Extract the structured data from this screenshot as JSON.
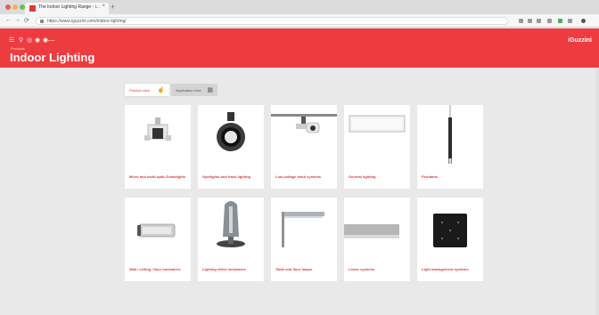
{
  "browser": {
    "tab_title": "The Indoor Lighting Range - i...",
    "tab_close": "×",
    "new_tab": "+",
    "back": "←",
    "forward": "→",
    "reload": "⟳",
    "url": "https://www.iguzzini.com/indoor-lighting/"
  },
  "header": {
    "brand": "iGuzzini",
    "breadcrumb": "Products",
    "title": "Indoor Lighting",
    "menu_icon": "☰",
    "search_icon": "⚲",
    "globe_icon": "◎",
    "user_icon": "◉",
    "more_icon": "◉—"
  },
  "views": {
    "product_view": "Product view",
    "application_view": "Application view"
  },
  "cards": [
    {
      "label": "Micro and multi-optic Downlights",
      "icon": "downlight"
    },
    {
      "label": "Spotlights and track lighting",
      "icon": "spotlight"
    },
    {
      "label": "Low-voltage track systems",
      "icon": "track"
    },
    {
      "label": "General lighting",
      "icon": "panel"
    },
    {
      "label": "Pendants",
      "icon": "pendant"
    },
    {
      "label": "Wall / ceiling / floor luminaires",
      "icon": "wall-luminaire"
    },
    {
      "label": "Lighting effect luminaires",
      "icon": "effect-luminaire"
    },
    {
      "label": "Table and floor lamps",
      "icon": "floor-lamp"
    },
    {
      "label": "Linear systems",
      "icon": "linear"
    },
    {
      "label": "Light management systems",
      "icon": "control-panel"
    }
  ],
  "colors": {
    "brand_red": "#ee3b3f",
    "label_red": "#e4373a"
  }
}
